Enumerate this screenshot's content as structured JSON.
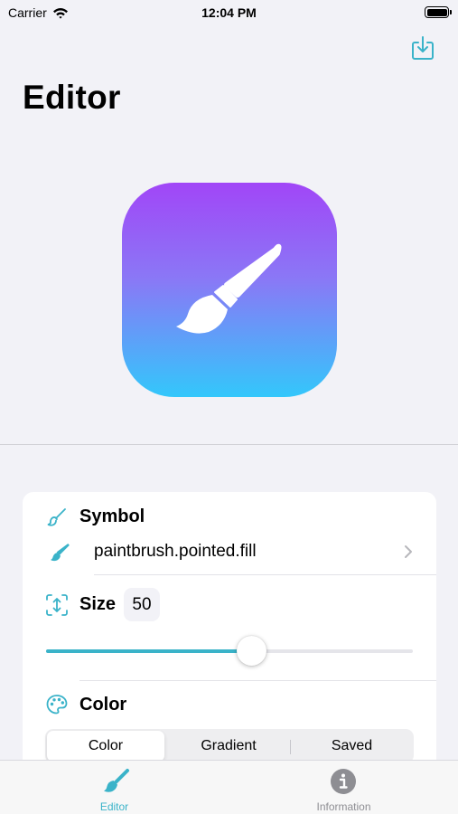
{
  "status_bar": {
    "carrier": "Carrier",
    "time": "12:04 PM"
  },
  "header": {
    "title": "Editor",
    "export_icon": "square-and-arrow-down-icon"
  },
  "preview": {
    "symbol_icon": "paintbrush-pointed-fill-icon",
    "gradient_colors": [
      "#a146f7",
      "#8a78f6",
      "#33c7fb"
    ]
  },
  "settings": {
    "symbol": {
      "label": "Symbol",
      "value": "paintbrush.pointed.fill"
    },
    "size": {
      "label": "Size",
      "value": "50",
      "slider_fraction": 0.56
    },
    "color": {
      "label": "Color",
      "segments": [
        "Color",
        "Gradient",
        "Saved"
      ],
      "selected": "Color"
    }
  },
  "tab_bar": {
    "tabs": [
      {
        "label": "Editor",
        "icon": "paintbrush-icon",
        "selected": true
      },
      {
        "label": "Information",
        "icon": "info-circle-icon",
        "selected": false
      }
    ]
  },
  "colors": {
    "accent": "#3ab3c9",
    "tab_inactive": "#8e8e93",
    "background": "#f2f2f7"
  }
}
